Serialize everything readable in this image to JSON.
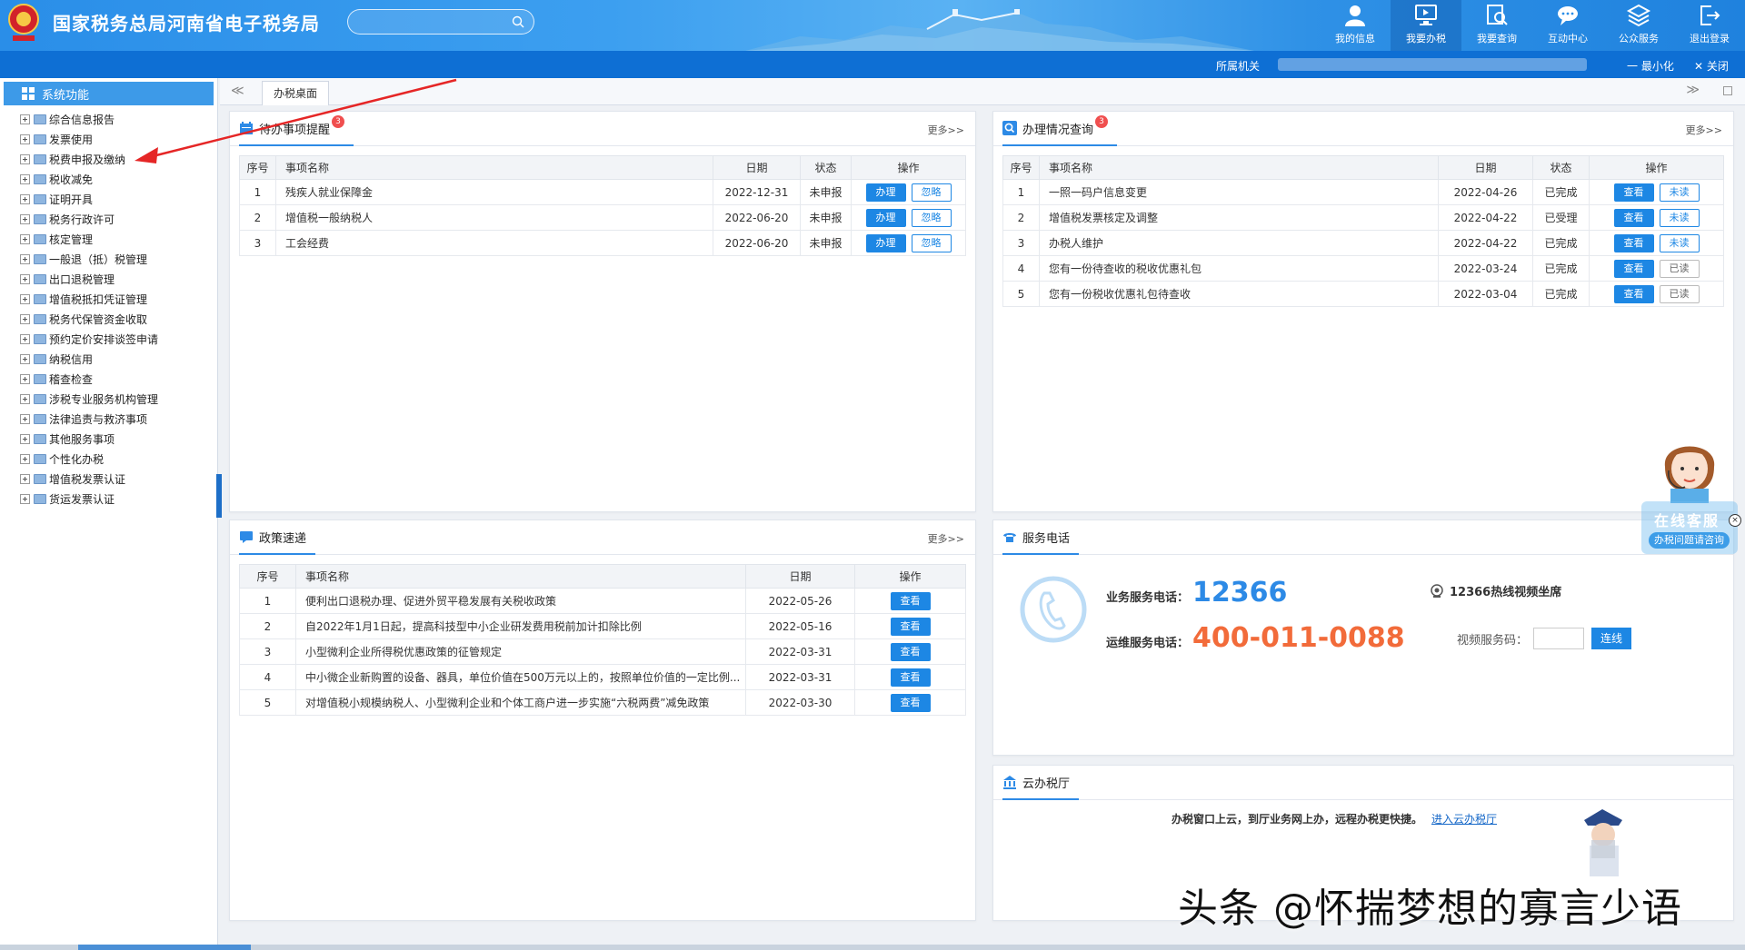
{
  "header": {
    "brand": "国家税务总局河南省电子税务局",
    "search_placeholder": "",
    "nav": [
      {
        "label": "我的信息",
        "icon": "user-icon"
      },
      {
        "label": "我要办税",
        "icon": "monitor-icon"
      },
      {
        "label": "我要查询",
        "icon": "search-doc-icon"
      },
      {
        "label": "互动中心",
        "icon": "chat-icon"
      },
      {
        "label": "公众服务",
        "icon": "stack-icon"
      },
      {
        "label": "退出登录",
        "icon": "logout-icon"
      }
    ]
  },
  "subbar": {
    "org_label": "所属机关",
    "minimize": "一 最小化",
    "close": "✕ 关闭"
  },
  "sidebar": {
    "title": "系统功能",
    "items": [
      "综合信息报告",
      "发票使用",
      "税费申报及缴纳",
      "税收减免",
      "证明开具",
      "税务行政许可",
      "核定管理",
      "一般退（抵）税管理",
      "出口退税管理",
      "增值税抵扣凭证管理",
      "税务代保管资金收取",
      "预约定价安排谈签申请",
      "纳税信用",
      "稽查检查",
      "涉税专业服务机构管理",
      "法律追责与救济事项",
      "其他服务事项",
      "个性化办税",
      "增值税发票认证",
      "货运发票认证"
    ]
  },
  "tabs": {
    "desk": "办税桌面",
    "left_nav": "≪",
    "right_nav": "≫"
  },
  "todo": {
    "title": "待办事项提醒",
    "badge": "3",
    "more": "更多>>",
    "headers": [
      "序号",
      "事项名称",
      "日期",
      "状态",
      "操作"
    ],
    "rows": [
      {
        "no": "1",
        "name": "残疾人就业保障金",
        "date": "2022-12-31",
        "status": "未申报"
      },
      {
        "no": "2",
        "name": "增值税一般纳税人",
        "date": "2022-06-20",
        "status": "未申报"
      },
      {
        "no": "3",
        "name": "工会经费",
        "date": "2022-06-20",
        "status": "未申报"
      }
    ],
    "btn_do": "办理",
    "btn_ignore": "忽略"
  },
  "query": {
    "title": "办理情况查询",
    "badge": "3",
    "more": "更多>>",
    "headers": [
      "序号",
      "事项名称",
      "日期",
      "状态",
      "操作"
    ],
    "rows": [
      {
        "no": "1",
        "name": "一照一码户信息变更",
        "date": "2022-04-26",
        "status": "已完成",
        "read": "未读"
      },
      {
        "no": "2",
        "name": "增值税发票核定及调整",
        "date": "2022-04-22",
        "status": "已受理",
        "read": "未读"
      },
      {
        "no": "3",
        "name": "办税人维护",
        "date": "2022-04-22",
        "status": "已完成",
        "read": "未读"
      },
      {
        "no": "4",
        "name": "您有一份待查收的税收优惠礼包",
        "date": "2022-03-24",
        "status": "已完成",
        "read": "已读"
      },
      {
        "no": "5",
        "name": "您有一份税收优惠礼包待查收",
        "date": "2022-03-04",
        "status": "已完成",
        "read": "已读"
      }
    ],
    "btn_view": "查看"
  },
  "policy": {
    "title": "政策速递",
    "more": "更多>>",
    "headers": [
      "序号",
      "事项名称",
      "日期",
      "操作"
    ],
    "rows": [
      {
        "no": "1",
        "name": "便利出口退税办理、促进外贸平稳发展有关税收政策",
        "date": "2022-05-26"
      },
      {
        "no": "2",
        "name": "自2022年1月1日起，提高科技型中小企业研发费用税前加计扣除比例",
        "date": "2022-05-16"
      },
      {
        "no": "3",
        "name": "小型微利企业所得税优惠政策的征管规定",
        "date": "2022-03-31"
      },
      {
        "no": "4",
        "name": "中小微企业新购置的设备、器具，单位价值在500万元以上的，按照单位价值的一定比例...",
        "date": "2022-03-31"
      },
      {
        "no": "5",
        "name": "对增值税小规模纳税人、小型微利企业和个体工商户进一步实施“六税两费”减免政策",
        "date": "2022-03-30"
      }
    ],
    "btn_view": "查看"
  },
  "service": {
    "title": "服务电话",
    "biz_label": "业务服务电话：",
    "biz_num": "12366",
    "ops_label": "运维服务电话：",
    "ops_num": "400-011-0088",
    "video_title": "12366热线视频坐席",
    "video_code_label": "视频服务码：",
    "connect": "连线"
  },
  "cloud": {
    "title": "云办税厅",
    "text": "办税窗口上云，到厅业务网上办，远程办税更快捷。",
    "enter": "进入云办税厅"
  },
  "chat": {
    "title": "在线客服",
    "sub": "办税问题请咨询",
    "close": "×"
  },
  "watermark": "头条 @怀揣梦想的寡言少语",
  "colors": {
    "primary": "#1d87e4",
    "header": "#2a8ee8",
    "alert": "#f05a3a"
  }
}
